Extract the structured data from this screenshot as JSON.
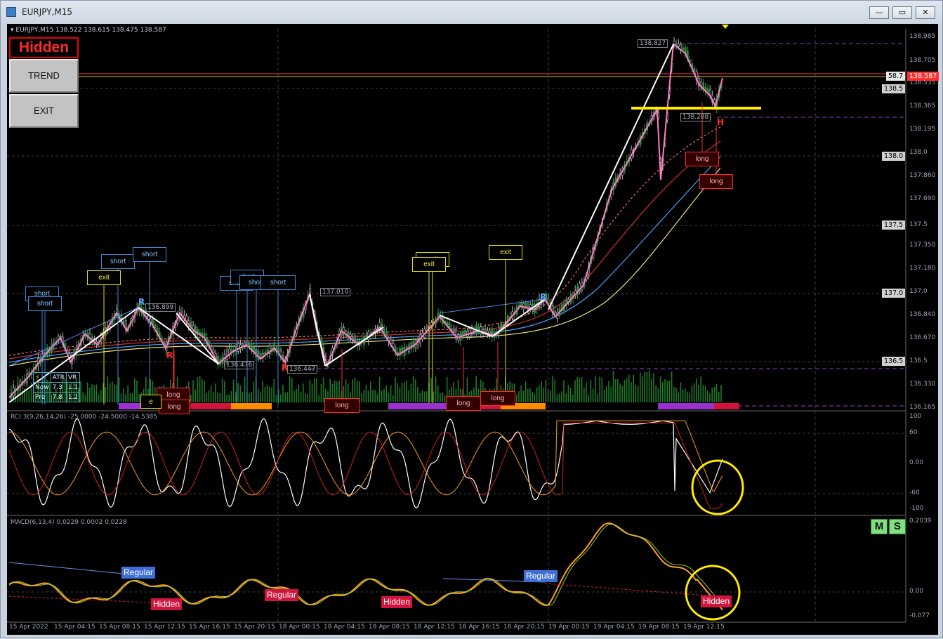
{
  "window": {
    "title": "EURJPY,M15",
    "minimize": "—",
    "restore": "▭",
    "close": "✕"
  },
  "colors": {
    "bg": "#000000",
    "bull": "#3a9a4a",
    "price_line": "#ff3b3b",
    "zigzag": "#ff7cc8",
    "trend": "#ffffff",
    "highlight": "#ffea00"
  },
  "symbol_info": "▾ EURJPY,M15  138.522 138.615 138.475 138.587",
  "panel": {
    "mode": "Hidden",
    "btn_trend": "TREND",
    "btn_exit": "EXIT"
  },
  "price_axis": [
    "138.985",
    "138.705",
    "138.535",
    "138.365",
    "138.195",
    "138.0",
    "137.860",
    "137.690",
    "137.5",
    "137.350",
    "137.180",
    "137.0",
    "136.840",
    "136.670",
    "136.5",
    "136.330",
    "136.165"
  ],
  "price_boxes": {
    "p138_5": "138.5",
    "p138_0": "138.0",
    "p137_5": "137.5",
    "p137_0": "137.0",
    "p136_5": "136.5",
    "current": "138.587",
    "rsi_val": "58.7"
  },
  "price_labels": {
    "high": "138.827",
    "low2": "138.288",
    "p137010": "137.010",
    "p136899": "136.899",
    "p136476": "136.476",
    "p136447": "136.447"
  },
  "letters": {
    "r1": "R",
    "r2": "R",
    "r3": "R",
    "r4": "R",
    "h": "H"
  },
  "signals": {
    "short": "short",
    "exit": "exit",
    "long": "long",
    "cut": "e"
  },
  "atr": {
    "h1": "ATR",
    "h2": "VR",
    "r1c0": "Now",
    "r1c1": "7.3",
    "r1c2": "1.1",
    "r2c0": "Pre",
    "r2c1": "7.8",
    "r2c2": "1.2"
  },
  "rci": {
    "label": "RCI 3(9,26,14,26)  -25.0000  -24.5000  -14.5385",
    "axis": [
      "100",
      "60",
      "0.00",
      "-60",
      "-100"
    ]
  },
  "macd": {
    "label": "MACD(6,13,4)  0.0229  0.0002  0.0228",
    "axis": [
      "0.2039",
      "0.00",
      "-0.077"
    ],
    "m": "M",
    "s": "S",
    "regular": "Regular",
    "hidden": "Hidden"
  },
  "time_axis": [
    "15 Apr 2022",
    "15 Apr 04:15",
    "15 Apr 08:15",
    "15 Apr 12:15",
    "15 Apr 16:15",
    "15 Apr 20:15",
    "18 Apr 00:15",
    "18 Apr 04:15",
    "18 Apr 08:15",
    "18 Apr 12:15",
    "18 Apr 16:15",
    "18 Apr 20:15",
    "19 Apr 00:15",
    "19 Apr 04:15",
    "19 Apr 08:15",
    "19 Apr 12:15"
  ]
}
